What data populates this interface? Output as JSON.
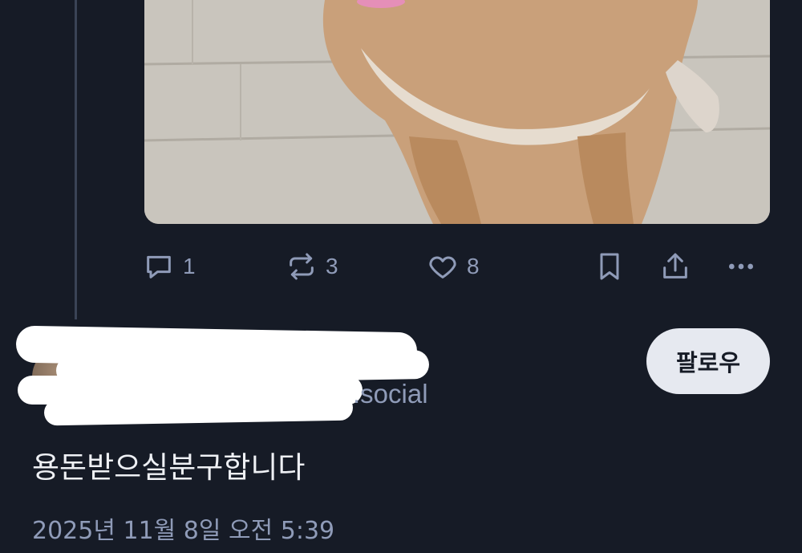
{
  "media": {
    "alt_icon": "dog-photo"
  },
  "actions": {
    "reply_count": "1",
    "repost_count": "3",
    "like_count": "8"
  },
  "author": {
    "handle_suffix": ".social",
    "follow_label": "팔로우"
  },
  "post": {
    "text": "용돈받으실분구합니다",
    "timestamp": "2025년 11월 8일 오전 5:39"
  },
  "icons": {
    "reply": "reply-icon",
    "repost": "repost-icon",
    "like": "like-icon",
    "bookmark": "bookmark-icon",
    "share": "share-icon",
    "more": "more-icon"
  }
}
